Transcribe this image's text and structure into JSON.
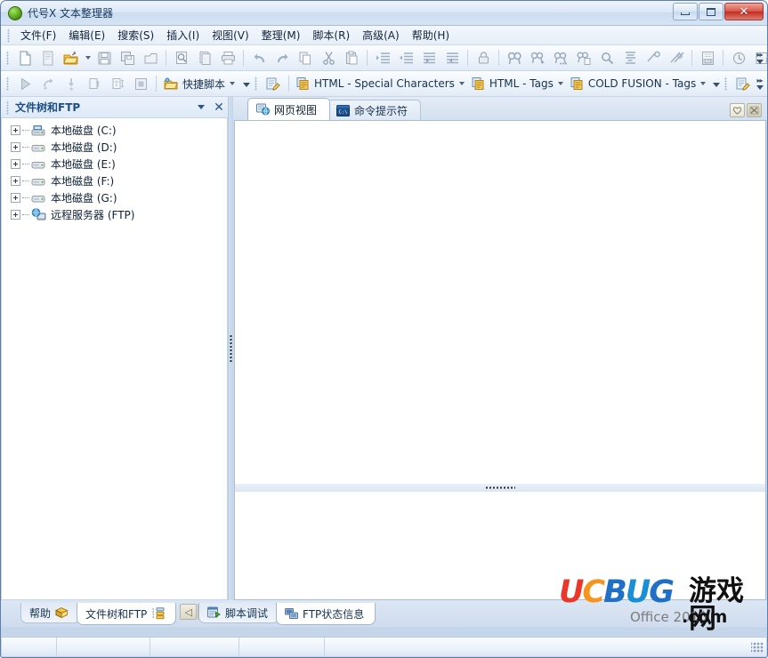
{
  "window": {
    "title": "代号X 文本整理器",
    "icon": "app-globe-icon",
    "minimize_label": "最小化",
    "maximize_label": "最大化",
    "close_label": "✕"
  },
  "menu": {
    "items": [
      {
        "label": "文件(F)",
        "name": "menu-file"
      },
      {
        "label": "编辑(E)",
        "name": "menu-edit"
      },
      {
        "label": "搜索(S)",
        "name": "menu-search"
      },
      {
        "label": "插入(I)",
        "name": "menu-insert"
      },
      {
        "label": "视图(V)",
        "name": "menu-view"
      },
      {
        "label": "整理(M)",
        "name": "menu-organize"
      },
      {
        "label": "脚本(R)",
        "name": "menu-script"
      },
      {
        "label": "高级(A)",
        "name": "menu-advanced"
      },
      {
        "label": "帮助(H)",
        "name": "menu-help"
      }
    ]
  },
  "toolbar_main": {
    "buttons": [
      {
        "icon": "new-file-icon",
        "enabled": true
      },
      {
        "icon": "new-from-template-icon",
        "enabled": false
      },
      {
        "icon": "open-folder-icon",
        "enabled": true,
        "dropdown": true
      },
      {
        "icon": "save-icon",
        "enabled": false
      },
      {
        "icon": "save-all-icon",
        "enabled": false
      },
      {
        "icon": "close-file-icon",
        "enabled": false
      },
      {
        "sep": true
      },
      {
        "icon": "print-preview-icon",
        "enabled": false
      },
      {
        "icon": "page-setup-icon",
        "enabled": false
      },
      {
        "icon": "print-icon",
        "enabled": false
      },
      {
        "sep": true
      },
      {
        "icon": "undo-icon",
        "enabled": false
      },
      {
        "icon": "redo-icon",
        "enabled": false
      },
      {
        "icon": "copy-icon",
        "enabled": false
      },
      {
        "icon": "cut-icon",
        "enabled": false
      },
      {
        "icon": "paste-icon",
        "enabled": false
      },
      {
        "sep": true
      },
      {
        "icon": "indent-increase-icon",
        "enabled": false
      },
      {
        "icon": "indent-decrease-icon",
        "enabled": false
      },
      {
        "icon": "comment-block-icon",
        "enabled": false
      },
      {
        "icon": "uncomment-block-icon",
        "enabled": false
      },
      {
        "sep": true
      },
      {
        "icon": "lock-icon",
        "enabled": false
      },
      {
        "sep": true
      },
      {
        "icon": "find-icon",
        "enabled": false
      },
      {
        "icon": "find-next-icon",
        "enabled": false
      },
      {
        "icon": "find-in-files-icon",
        "enabled": false
      },
      {
        "icon": "replace-icon",
        "enabled": false
      },
      {
        "icon": "search-preview-icon",
        "enabled": false
      },
      {
        "icon": "sort-icon",
        "enabled": false
      },
      {
        "icon": "bookmark-toggle-icon",
        "enabled": false
      },
      {
        "icon": "bookmark-clear-icon",
        "enabled": false
      },
      {
        "sep": true
      },
      {
        "icon": "column-marker-icon",
        "enabled": false
      },
      {
        "sep": true
      },
      {
        "icon": "insert-time-icon",
        "enabled": false
      },
      {
        "icon": "insert-page-icon",
        "enabled": false
      }
    ],
    "overflow_label": "▾"
  },
  "toolbar_script": {
    "buttons": [
      {
        "icon": "run-icon",
        "enabled": false
      },
      {
        "icon": "step-over-icon",
        "enabled": false
      },
      {
        "icon": "step-into-icon",
        "enabled": false
      },
      {
        "icon": "step-out-icon",
        "enabled": false
      },
      {
        "icon": "text-format-icon",
        "enabled": false
      },
      {
        "icon": "stop-icon",
        "enabled": false
      }
    ],
    "quick_script_label": "快捷脚本",
    "quick_script_icon": "quick-script-icon",
    "edit_script_icon": "edit-script-icon",
    "dropdowns": [
      {
        "label": "HTML - Special Characters",
        "icon": "tag-library-icon",
        "name": "html-special-characters-dropdown"
      },
      {
        "label": "HTML - Tags",
        "icon": "tag-library-icon",
        "name": "html-tags-dropdown"
      },
      {
        "label": "COLD FUSION - Tags",
        "icon": "tag-library-icon",
        "name": "cold-fusion-tags-dropdown"
      }
    ],
    "tail_icon": "edit-tag-library-icon"
  },
  "left_panel": {
    "title": "文件树和FTP",
    "menu_button": "panel-menu-button",
    "close_button": "panel-close-button",
    "tree": [
      {
        "label": "本地磁盘 (C:)",
        "icon": "system-drive-icon"
      },
      {
        "label": "本地磁盘 (D:)",
        "icon": "drive-icon"
      },
      {
        "label": "本地磁盘 (E:)",
        "icon": "drive-icon"
      },
      {
        "label": "本地磁盘 (F:)",
        "icon": "drive-icon"
      },
      {
        "label": "本地磁盘 (G:)",
        "icon": "drive-icon"
      },
      {
        "label": "远程服务器 (FTP)",
        "icon": "remote-server-icon"
      }
    ]
  },
  "document_tabs": {
    "tabs": [
      {
        "label": "网页视图",
        "icon": "web-view-icon",
        "active": true
      },
      {
        "label": "命令提示符",
        "icon": "command-prompt-icon",
        "active": false
      }
    ],
    "right_buttons": [
      {
        "name": "favorite-button",
        "icon": "heart-icon"
      },
      {
        "name": "close-tab-button",
        "icon": "close-x-icon"
      }
    ]
  },
  "editor": {
    "content": "",
    "output_content": ""
  },
  "bottom_tabs": {
    "left": [
      {
        "label": "帮助",
        "icon": "help-icon",
        "active": false
      },
      {
        "label": "文件树和FTP",
        "icon": "file-tree-ftp-icon",
        "active": true
      }
    ],
    "nav": [
      {
        "name": "scroll-tabs-left-button",
        "glyph": "◁"
      },
      {
        "name": "scroll-tabs-right-button",
        "glyph": "▷"
      }
    ],
    "center": [
      {
        "label": "脚本调试",
        "icon": "script-debug-icon",
        "active": false
      },
      {
        "label": "FTP状态信息",
        "icon": "ftp-status-icon",
        "active": true
      }
    ]
  },
  "statusbar": {
    "cells": [
      "",
      "",
      "",
      "",
      ""
    ]
  },
  "watermark": {
    "u": "U",
    "c": "C",
    "b": "B",
    "u2": "U",
    "g": "G",
    "cn": "游戏网",
    "office": "Office 2010",
    "dotcom": ".com"
  },
  "colors": {
    "accent": "#1d4f86",
    "title_text": "#14365c",
    "close_button": "#bf2d21",
    "watermark_red": "#e8382a",
    "watermark_orange": "#f6941e",
    "watermark_blue": "#2070c8"
  }
}
